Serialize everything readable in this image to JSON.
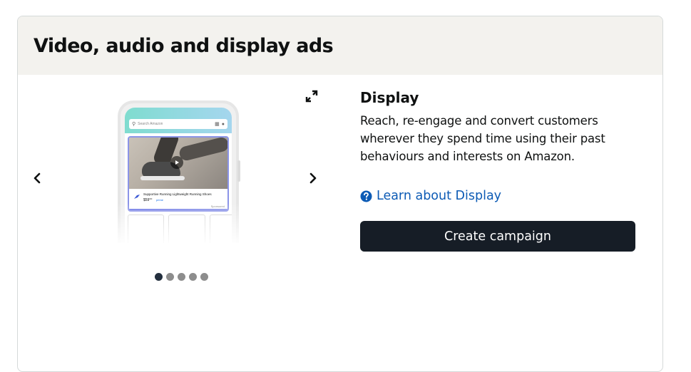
{
  "card": {
    "title": "Video, audio and display ads"
  },
  "carousel": {
    "prev_icon": "chevron-left-icon",
    "next_icon": "chevron-right-icon",
    "expand_icon": "expand-icon",
    "slide_count": 5,
    "active_index": 0,
    "phone_mock": {
      "search_placeholder": "Search Amazon",
      "product_title": "Supportive Running Lightweight Running Shoes",
      "price": "$59⁰⁰",
      "prime_label": "prime",
      "sponsored_label": "Sponsored"
    }
  },
  "panel": {
    "title": "Display",
    "description": "Reach, re-engage and convert customers wherever they spend time using their past behaviours and interests on Amazon.",
    "learn_link": "Learn about Display",
    "learn_icon": "help-circle-icon",
    "create_button": "Create campaign"
  },
  "colors": {
    "header_bg": "#f3f2ee",
    "link": "#0d5bb5",
    "button_bg": "#161d26",
    "dot_active": "#232f3e",
    "dot_inactive": "#8d8d8d"
  }
}
